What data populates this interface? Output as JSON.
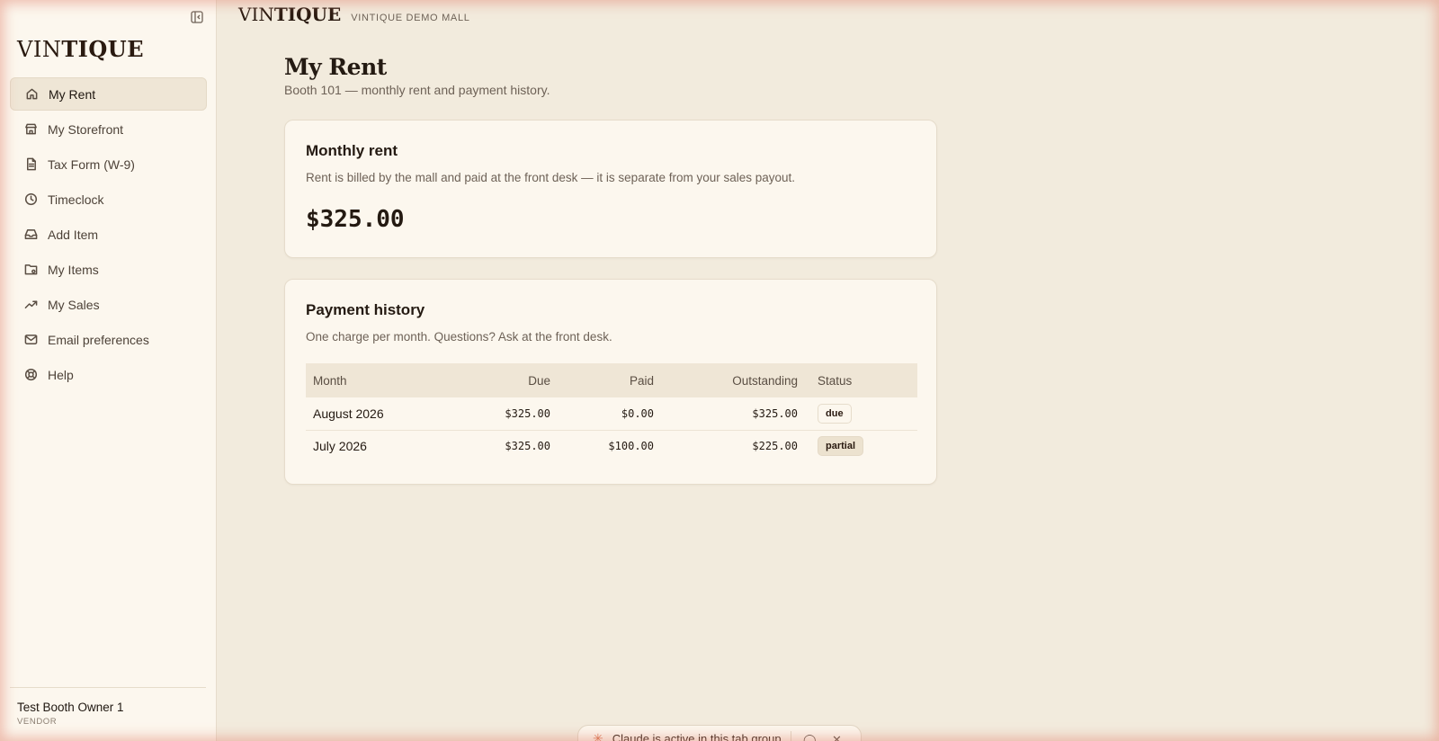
{
  "brand": {
    "logo_light": "VIN",
    "logo_bold": "TIQUE",
    "mall_name": "VINTIQUE DEMO MALL"
  },
  "sidebar": {
    "items": [
      {
        "label": "My Rent",
        "icon": "home-icon",
        "active": true
      },
      {
        "label": "My Storefront",
        "icon": "store-icon"
      },
      {
        "label": "Tax Form (W-9)",
        "icon": "document-icon"
      },
      {
        "label": "Timeclock",
        "icon": "clock-icon"
      },
      {
        "label": "Add Item",
        "icon": "inbox-icon"
      },
      {
        "label": "My Items",
        "icon": "folder-icon"
      },
      {
        "label": "My Sales",
        "icon": "trending-up-icon"
      },
      {
        "label": "Email preferences",
        "icon": "mail-icon"
      },
      {
        "label": "Help",
        "icon": "lifebuoy-icon"
      }
    ],
    "user": {
      "name": "Test Booth Owner 1",
      "role": "VENDOR"
    }
  },
  "main": {
    "title": "My Rent",
    "subtitle": "Booth 101 — monthly rent and payment history.",
    "rent_card": {
      "title": "Monthly rent",
      "description": "Rent is billed by the mall and paid at the front desk — it is separate from your sales payout.",
      "amount": "$325.00"
    },
    "history_card": {
      "title": "Payment history",
      "description": "One charge per month. Questions? Ask at the front desk.",
      "columns": [
        "Month",
        "Due",
        "Paid",
        "Outstanding",
        "Status"
      ],
      "rows": [
        {
          "month": "August 2026",
          "due": "$325.00",
          "paid": "$0.00",
          "outstanding": "$325.00",
          "status": "due"
        },
        {
          "month": "July 2026",
          "due": "$325.00",
          "paid": "$100.00",
          "outstanding": "$225.00",
          "status": "partial"
        }
      ]
    }
  },
  "toast": {
    "text": "Claude is active in this tab group"
  }
}
